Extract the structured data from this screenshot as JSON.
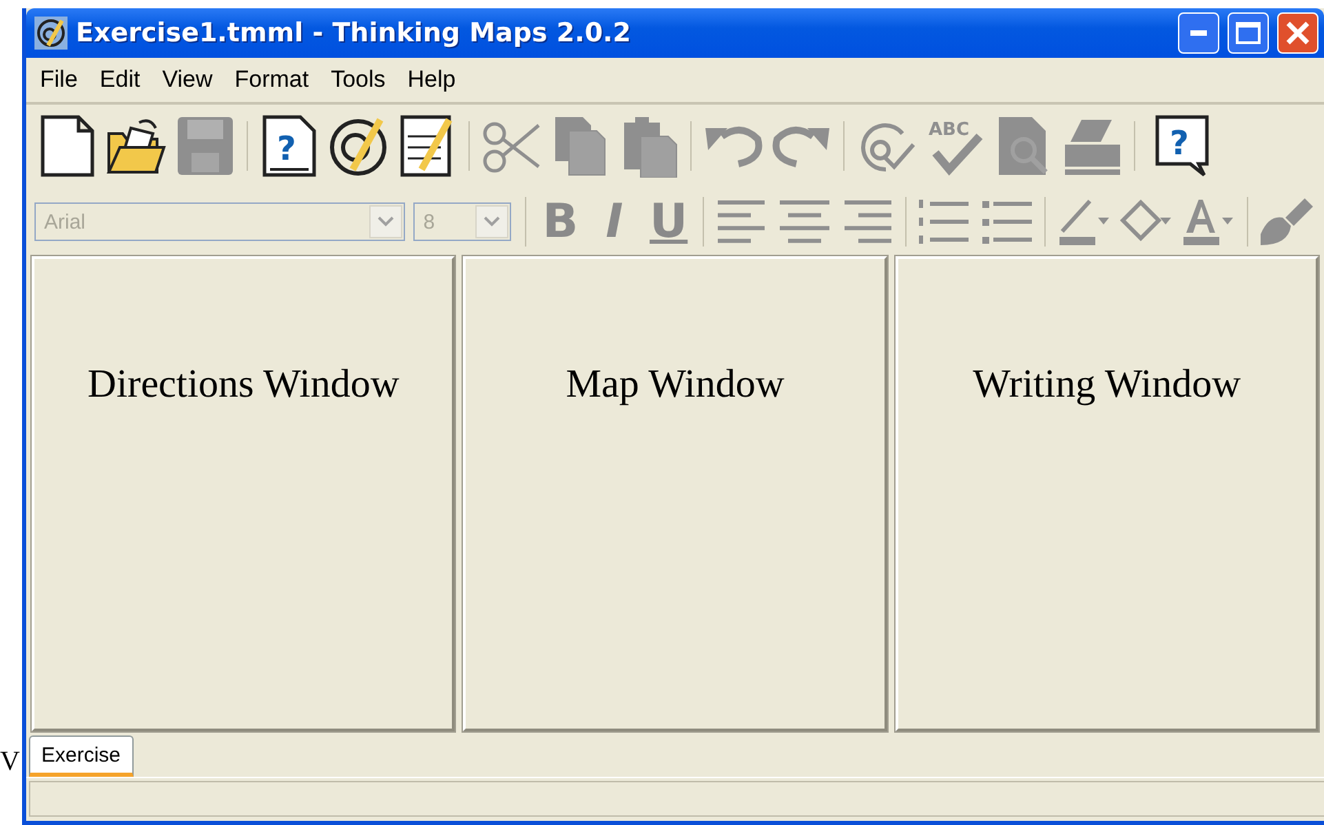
{
  "backdrop_text": "V",
  "window": {
    "title": "Exercise1.tmml - Thinking Maps 2.0.2"
  },
  "menu": [
    "File",
    "Edit",
    "View",
    "Format",
    "Tools",
    "Help"
  ],
  "toolbar": [
    [
      {
        "kind": "new",
        "disabled": false
      },
      {
        "kind": "open",
        "disabled": false
      },
      {
        "kind": "save",
        "disabled": true
      }
    ],
    [
      {
        "kind": "help-doc",
        "disabled": false,
        "glyph": "?"
      },
      {
        "kind": "map",
        "disabled": false
      },
      {
        "kind": "edit",
        "disabled": false
      }
    ],
    [
      {
        "kind": "cut",
        "disabled": true
      },
      {
        "kind": "copy",
        "disabled": true
      },
      {
        "kind": "paste",
        "disabled": true
      }
    ],
    [
      {
        "kind": "undo",
        "disabled": true
      },
      {
        "kind": "redo",
        "disabled": true
      }
    ],
    [
      {
        "kind": "check",
        "disabled": true
      },
      {
        "kind": "spell",
        "disabled": true,
        "glyph": "ABC"
      },
      {
        "kind": "preview",
        "disabled": true
      },
      {
        "kind": "print",
        "disabled": true
      }
    ],
    [
      {
        "kind": "help",
        "disabled": false,
        "glyph": "?"
      }
    ]
  ],
  "format_bar": {
    "font": {
      "value": "Arial",
      "disabled": true
    },
    "size": {
      "value": "8",
      "disabled": true
    },
    "styles": [
      {
        "label": "B",
        "kind": "bold"
      },
      {
        "label": "I",
        "kind": "italic"
      },
      {
        "label": "U",
        "kind": "underline"
      }
    ],
    "tools": [
      [
        {
          "kind": "align-left"
        },
        {
          "kind": "align-center"
        },
        {
          "kind": "align-right"
        }
      ],
      [
        {
          "kind": "numbered-list"
        },
        {
          "kind": "bullet-list"
        }
      ],
      [
        {
          "kind": "line-color"
        },
        {
          "kind": "fill-color"
        },
        {
          "kind": "font-color"
        }
      ],
      [
        {
          "kind": "brush"
        }
      ]
    ]
  },
  "panes": [
    {
      "label": "Directions Window"
    },
    {
      "label": "Map Window"
    },
    {
      "label": "Writing Window"
    }
  ],
  "tabs": [
    {
      "label": "Exercise",
      "selected": true
    }
  ]
}
